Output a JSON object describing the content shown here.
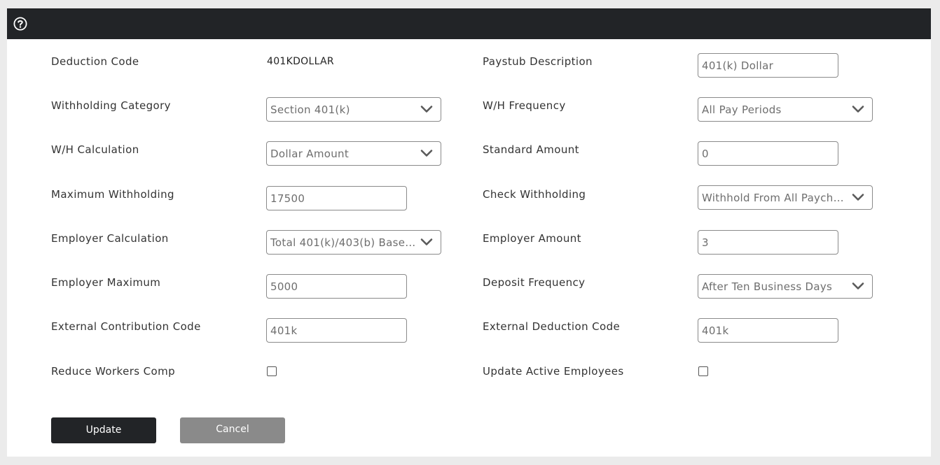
{
  "form": {
    "deduction_code": {
      "label": "Deduction Code",
      "value": "401KDOLLAR"
    },
    "paystub_description": {
      "label": "Paystub Description",
      "value": "401(k) Dollar"
    },
    "withholding_category": {
      "label": "Withholding Category",
      "value": "Section 401(k)"
    },
    "wh_frequency": {
      "label": "W/H Frequency",
      "value": "All Pay Periods"
    },
    "wh_calculation": {
      "label": "W/H Calculation",
      "value": "Dollar Amount"
    },
    "standard_amount": {
      "label": "Standard Amount",
      "value": "0"
    },
    "maximum_withholding": {
      "label": "Maximum Withholding",
      "value": "17500"
    },
    "check_withholding": {
      "label": "Check Withholding",
      "value": "Withhold From All Payche..."
    },
    "employer_calculation": {
      "label": "Employer Calculation",
      "value": "Total 401(k)/403(b) Base ..."
    },
    "employer_amount": {
      "label": "Employer Amount",
      "value": "3"
    },
    "employer_maximum": {
      "label": "Employer Maximum",
      "value": "5000"
    },
    "deposit_frequency": {
      "label": "Deposit Frequency",
      "value": "After Ten Business Days"
    },
    "external_contribution_code": {
      "label": "External Contribution Code",
      "value": "401k"
    },
    "external_deduction_code": {
      "label": "External Deduction Code",
      "value": "401k"
    },
    "reduce_workers_comp": {
      "label": "Reduce Workers Comp",
      "checked": false
    },
    "update_active_employees": {
      "label": "Update Active Employees",
      "checked": false
    }
  },
  "actions": {
    "update_label": "Update",
    "cancel_label": "Cancel"
  },
  "icons": {
    "help": "help-icon",
    "dropdown": "chevron-down-icon"
  },
  "colors": {
    "header_bg": "#222427",
    "primary_button": "#222427",
    "secondary_button": "#8a8a8a"
  }
}
